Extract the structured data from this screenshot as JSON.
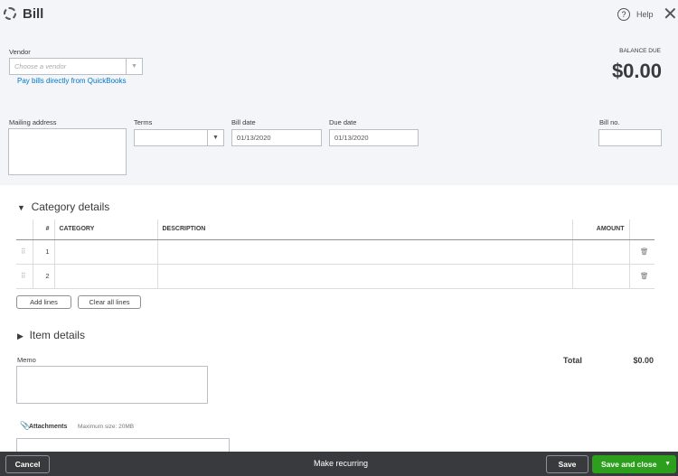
{
  "header": {
    "title": "Bill",
    "help": "Help"
  },
  "vendor": {
    "label": "Vendor",
    "placeholder": "Choose a vendor",
    "link": "Pay bills directly from QuickBooks"
  },
  "balance": {
    "label": "BALANCE DUE",
    "value": "$0.00"
  },
  "fields": {
    "mailing": "Mailing address",
    "terms": "Terms",
    "bill_date_label": "Bill date",
    "bill_date": "01/13/2020",
    "due_date_label": "Due date",
    "due_date": "01/13/2020",
    "bill_no": "Bill no."
  },
  "category": {
    "title": "Category details",
    "columns": [
      "#",
      "CATEGORY",
      "DESCRIPTION",
      "AMOUNT"
    ],
    "rows": [
      "1",
      "2"
    ],
    "add_lines": "Add lines",
    "clear_lines": "Clear all lines"
  },
  "items": {
    "title": "Item details"
  },
  "memo": {
    "label": "Memo"
  },
  "total": {
    "label": "Total",
    "value": "$0.00"
  },
  "attachments": {
    "label": "Attachments",
    "max": "Maximum size: 20MB"
  },
  "footer": {
    "cancel": "Cancel",
    "recurring": "Make recurring",
    "save": "Save",
    "save_close": "Save and close"
  },
  "colors": {
    "green": "#2ca01c",
    "link": "#0077c5",
    "footer": "#393a3d"
  }
}
